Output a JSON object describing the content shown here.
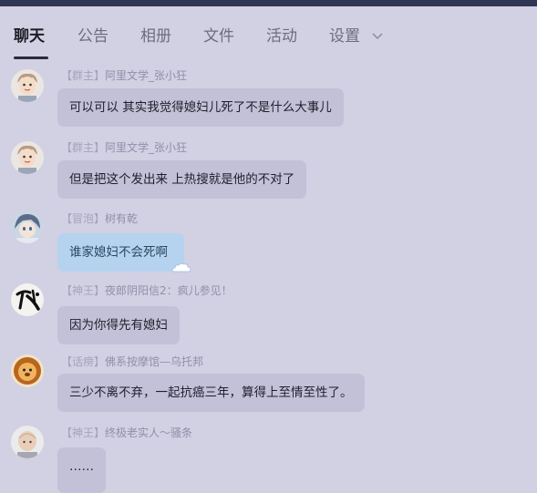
{
  "tabs": [
    {
      "label": "聊天",
      "active": true
    },
    {
      "label": "公告",
      "active": false
    },
    {
      "label": "相册",
      "active": false
    },
    {
      "label": "文件",
      "active": false
    },
    {
      "label": "活动",
      "active": false
    },
    {
      "label": "设置",
      "active": false
    }
  ],
  "messages": [
    {
      "badge": "【群主】",
      "sender": "阿里文学_张小狂",
      "text": "可以可以  其实我觉得媳妇儿死了不是什么大事儿",
      "avatar": "cartoon-person-avatar"
    },
    {
      "badge": "【群主】",
      "sender": "阿里文学_张小狂",
      "text": "但是把这个发出来  上热搜就是他的不对了",
      "avatar": "cartoon-person-avatar"
    },
    {
      "badge": "【冒泡】",
      "sender": "树有乾",
      "text": "谁家媳妇不会死啊",
      "avatar": "anime-character-avatar",
      "bubble_color": "#b5d3ef"
    },
    {
      "badge": "【神王】",
      "sender": "夜郎阴阳信2：疯儿参见！",
      "text": "因为你得先有媳妇",
      "avatar": "calligraphy-avatar"
    },
    {
      "badge": "【话痨】",
      "sender": "佛系按摩馆—乌托邦",
      "text": "三少不离不弃，一起抗癌三年，算得上至情至性了。",
      "avatar": "lion-cartoon-avatar"
    },
    {
      "badge": "【神王】",
      "sender": "终极老实人～骚条",
      "text": "……",
      "avatar": "cartoon-monk-avatar"
    }
  ],
  "colors": {
    "background": "#d2d0e3",
    "bubble": "#c2c1d8",
    "bubble_highlight": "#b5d3ef",
    "header_bar": "#2f3655"
  }
}
